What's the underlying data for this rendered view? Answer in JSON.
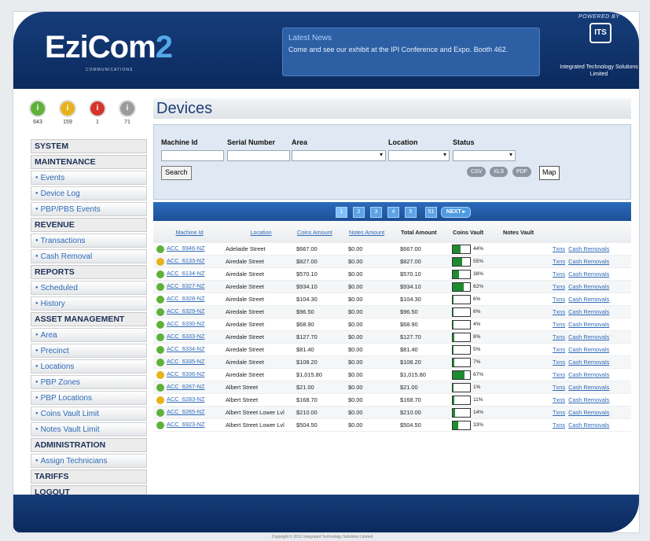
{
  "header": {
    "logo_main": "EziCom",
    "logo_num": "2",
    "logo_sub": "COMMUNICATIONS",
    "news_title": "Latest News",
    "news_body": "Come and see our exhibit at the IPI Conference and Expo. Booth 462.",
    "powered_by": "POWERED BY",
    "partner_logo": "ITS",
    "partner_name": "Integrated Technology Solutions Limited"
  },
  "stats": [
    {
      "label": "643",
      "color": "#5fb13a"
    },
    {
      "label": "159",
      "color": "#e8b21c"
    },
    {
      "label": "1",
      "color": "#d6342b"
    },
    {
      "label": "71",
      "color": "#9b9b9b"
    }
  ],
  "page_title": "Devices",
  "sidebar": {
    "system": "SYSTEM",
    "maintenance": "MAINTENANCE",
    "events": "Events",
    "device_log": "Device Log",
    "pbp_events": "PBP/PBS Events",
    "revenue": "REVENUE",
    "transactions": "Transactions",
    "cash_removal": "Cash Removal",
    "reports": "REPORTS",
    "scheduled": "Scheduled",
    "history": "History",
    "asset_management": "ASSET MANAGEMENT",
    "area": "Area",
    "precinct": "Precinct",
    "locations": "Locations",
    "pbp_zones": "PBP Zones",
    "pbp_locations": "PBP Locations",
    "coins_vault_limit": "Coins Vault Limit",
    "notes_vault_limit": "Notes Vault Limit",
    "administration": "ADMINISTRATION",
    "assign_technicians": "Assign Technicians",
    "tariffs": "TARIFFS",
    "logout": "LOGOUT"
  },
  "filters": {
    "machine_id_label": "Machine Id",
    "serial_number_label": "Serial Number",
    "area_label": "Area",
    "location_label": "Location",
    "status_label": "Status",
    "search_button": "Search",
    "csv_button": "CSV",
    "xls_button": "XLS",
    "pdf_button": "PDF",
    "map_button": "Map"
  },
  "pager": {
    "pages": [
      "1",
      "2",
      "3",
      "4",
      "5",
      "51"
    ],
    "next": "NEXT"
  },
  "table": {
    "headers": {
      "machine_id": "Machine Id",
      "location": "Location",
      "coins_amount": "Coins Amount",
      "notes_amount": "Notes Amount",
      "total_amount": "Total Amount",
      "coins_vault": "Coins Vault",
      "notes_vault": "Notes Vault"
    },
    "txns_link": "Txns",
    "cash_link": "Cash Removals",
    "status_colors": {
      "ok": "#5fb13a",
      "warn": "#e8b21c"
    },
    "rows": [
      {
        "status": "ok",
        "machine": "ACC_6946-NZ",
        "location": "Adelaide Street",
        "coins": "$667.00",
        "notes": "$0.00",
        "total": "$667.00",
        "vault": 44,
        "vault_label": "44%"
      },
      {
        "status": "warn",
        "machine": "ACC_6133-NZ",
        "location": "Airedale Street",
        "coins": "$827.00",
        "notes": "$0.00",
        "total": "$827.00",
        "vault": 55,
        "vault_label": "55%"
      },
      {
        "status": "ok",
        "machine": "ACC_6134-NZ",
        "location": "Airedale Street",
        "coins": "$570.10",
        "notes": "$0.00",
        "total": "$570.10",
        "vault": 38,
        "vault_label": "38%"
      },
      {
        "status": "ok",
        "machine": "ACC_6327-NZ",
        "location": "Airedale Street",
        "coins": "$934.10",
        "notes": "$0.00",
        "total": "$934.10",
        "vault": 62,
        "vault_label": "62%"
      },
      {
        "status": "ok",
        "machine": "ACC_6328-NZ",
        "location": "Airedale Street",
        "coins": "$104.30",
        "notes": "$0.00",
        "total": "$104.30",
        "vault": 6,
        "vault_label": "6%"
      },
      {
        "status": "ok",
        "machine": "ACC_6329-NZ",
        "location": "Airedale Street",
        "coins": "$96.50",
        "notes": "$0.00",
        "total": "$96.50",
        "vault": 6,
        "vault_label": "6%"
      },
      {
        "status": "ok",
        "machine": "ACC_6330-NZ",
        "location": "Airedale Street",
        "coins": "$68.90",
        "notes": "$0.00",
        "total": "$68.90",
        "vault": 4,
        "vault_label": "4%"
      },
      {
        "status": "ok",
        "machine": "ACC_6333-NZ",
        "location": "Airedale Street",
        "coins": "$127.70",
        "notes": "$0.00",
        "total": "$127.70",
        "vault": 8,
        "vault_label": "8%"
      },
      {
        "status": "ok",
        "machine": "ACC_6334-NZ",
        "location": "Airedale Street",
        "coins": "$81.40",
        "notes": "$0.00",
        "total": "$81.40",
        "vault": 5,
        "vault_label": "5%"
      },
      {
        "status": "ok",
        "machine": "ACC_6335-NZ",
        "location": "Airedale Street",
        "coins": "$108.20",
        "notes": "$0.00",
        "total": "$108.20",
        "vault": 7,
        "vault_label": "7%"
      },
      {
        "status": "warn",
        "machine": "ACC_6336-NZ",
        "location": "Airedale Street",
        "coins": "$1,015.80",
        "notes": "$0.00",
        "total": "$1,015.80",
        "vault": 67,
        "vault_label": "67%"
      },
      {
        "status": "ok",
        "machine": "ACC_6267-NZ",
        "location": "Albert Street",
        "coins": "$21.00",
        "notes": "$0.00",
        "total": "$21.00",
        "vault": 1,
        "vault_label": "1%"
      },
      {
        "status": "warn",
        "machine": "ACC_6283-NZ",
        "location": "Albert Street",
        "coins": "$168.70",
        "notes": "$0.00",
        "total": "$168.70",
        "vault": 11,
        "vault_label": "11%"
      },
      {
        "status": "ok",
        "machine": "ACC_6265-NZ",
        "location": "Albert Street Lower Lvl",
        "coins": "$210.00",
        "notes": "$0.00",
        "total": "$210.00",
        "vault": 14,
        "vault_label": "14%"
      },
      {
        "status": "ok",
        "machine": "ACC_6923-NZ",
        "location": "Albert Street Lower Lvl",
        "coins": "$504.50",
        "notes": "$0.00",
        "total": "$504.50",
        "vault": 33,
        "vault_label": "33%"
      }
    ]
  },
  "footer": {
    "copyright": "Copyright © 2011 Integrated Technology Solutions Limited"
  }
}
